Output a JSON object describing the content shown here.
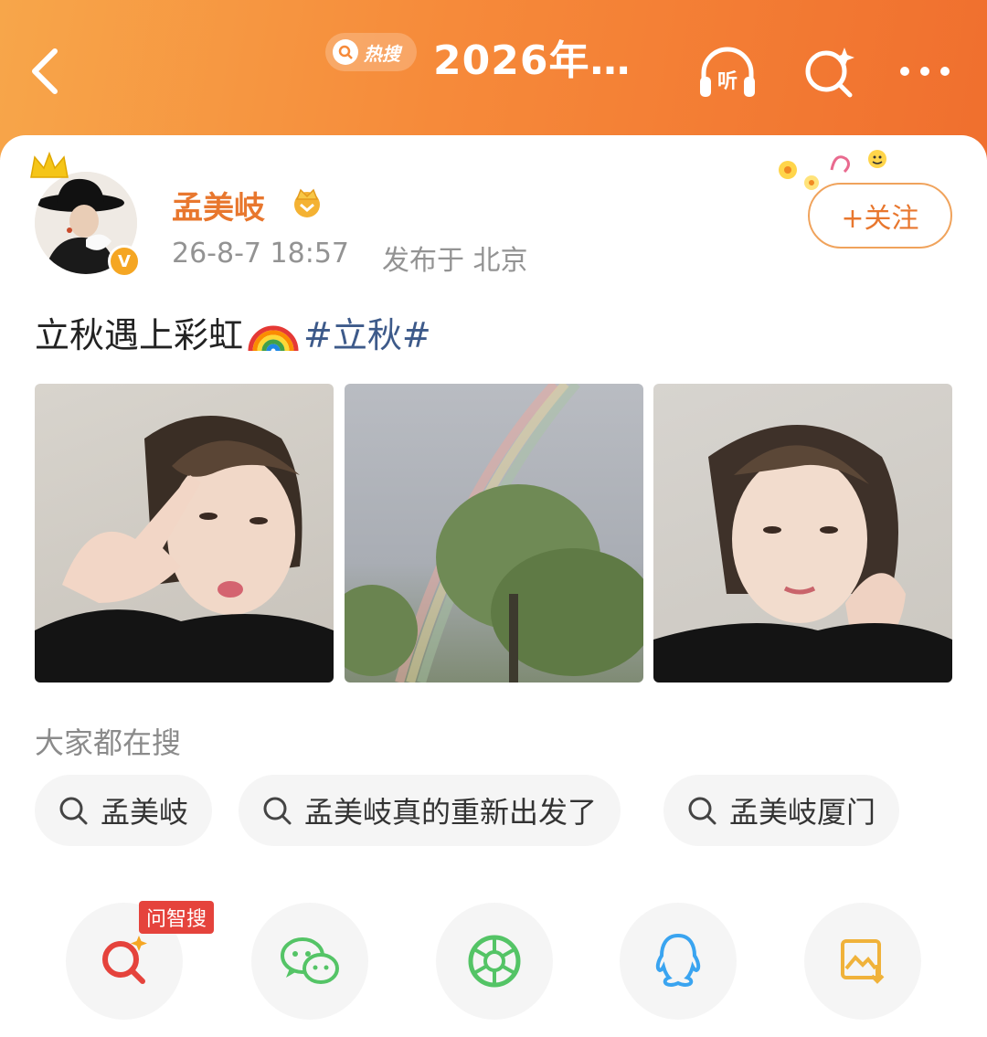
{
  "header": {
    "hot_badge": "热搜",
    "title": "2026年…"
  },
  "post": {
    "user_name": "孟美岐",
    "time": "26-8-7 18:57",
    "location": "发布于 北京",
    "follow_label": "+关注",
    "text": "立秋遇上彩虹",
    "hashtag": "#立秋#"
  },
  "searches": {
    "title": "大家都在搜",
    "items": [
      "孟美岐",
      "孟美岐真的重新出发了",
      "孟美岐厦门"
    ]
  },
  "share": {
    "ai_badge": "问智搜",
    "icons": [
      "ai-search-icon",
      "wechat-icon",
      "moments-icon",
      "qq-icon",
      "save-image-icon"
    ]
  },
  "colors": {
    "header_orange": "#f68a3a",
    "name_orange": "#e8772e",
    "hashtag_blue": "#3d5a8a",
    "wechat_green": "#54c466",
    "qq_blue": "#3aa4f0",
    "save_yellow": "#f0b23a",
    "badge_red": "#e5433c"
  }
}
